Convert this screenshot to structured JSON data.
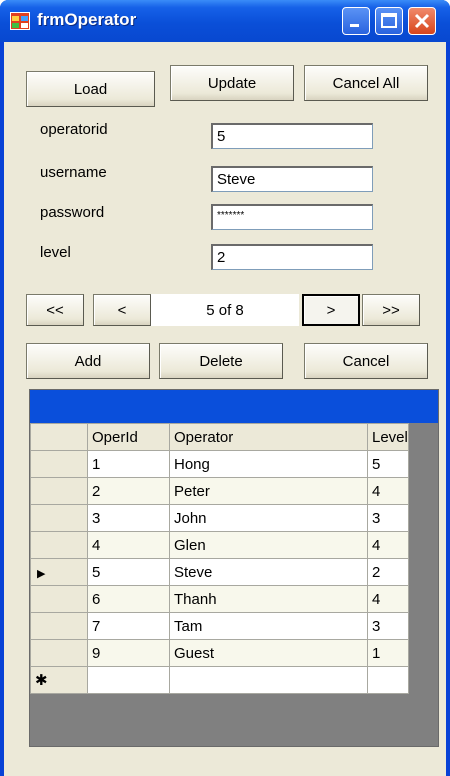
{
  "window": {
    "title": "frmOperator"
  },
  "toolbar": {
    "load": "Load",
    "update": "Update",
    "cancel_all": "Cancel All"
  },
  "fields": {
    "operatorid": {
      "label": "operatorid",
      "value": "5"
    },
    "username": {
      "label": "username",
      "value": "Steve"
    },
    "password": {
      "label": "password",
      "value": "*******"
    },
    "level": {
      "label": "level",
      "value": "2"
    }
  },
  "navigator": {
    "first": "<<",
    "prev": "<",
    "position": "5 of  8",
    "next": ">",
    "last": ">>"
  },
  "actions": {
    "add": "Add",
    "delete": "Delete",
    "cancel": "Cancel"
  },
  "grid": {
    "columns": [
      "OperId",
      "Operator",
      "Level"
    ],
    "rows": [
      [
        "1",
        "Hong",
        "5"
      ],
      [
        "2",
        "Peter",
        "4"
      ],
      [
        "3",
        "John",
        "3"
      ],
      [
        "4",
        "Glen",
        "4"
      ],
      [
        "5",
        "Steve",
        "2"
      ],
      [
        "6",
        "Thanh",
        "4"
      ],
      [
        "7",
        "Tam",
        "3"
      ],
      [
        "9",
        "Guest",
        "1"
      ]
    ],
    "current_row_marker": "▶",
    "new_row_marker": "✱"
  },
  "colors": {
    "titlebar": "#0a4fd8",
    "client": "#ece9d8",
    "grid_caption": "#0a4fdb"
  }
}
